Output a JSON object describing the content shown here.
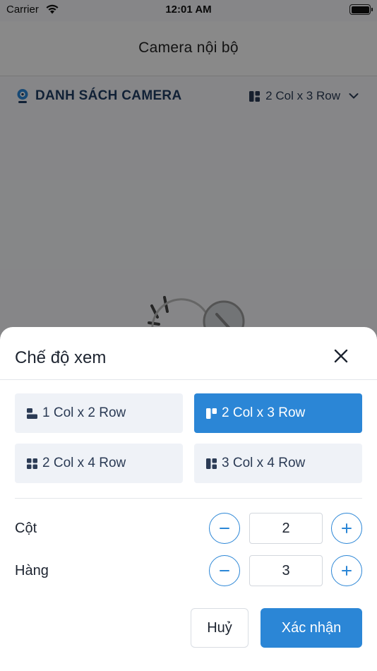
{
  "status_bar": {
    "carrier": "Carrier",
    "time": "12:01 AM"
  },
  "header": {
    "title": "Camera nội bộ"
  },
  "camera_list": {
    "title": "DANH SÁCH CAMERA",
    "current_layout": "2 Col x 3 Row"
  },
  "sheet": {
    "title": "Chế độ xem",
    "options": [
      {
        "label": "1 Col x 2 Row",
        "selected": false
      },
      {
        "label": "2 Col x 3 Row",
        "selected": true
      },
      {
        "label": "2 Col x 4 Row",
        "selected": false
      },
      {
        "label": "3 Col x 4 Row",
        "selected": false
      }
    ],
    "columns": {
      "label": "Cột",
      "value": "2"
    },
    "rows": {
      "label": "Hàng",
      "value": "3"
    },
    "cancel_label": "Huỷ",
    "confirm_label": "Xác nhận"
  },
  "colors": {
    "accent": "#2b86d6",
    "title_dark": "#1f3d63",
    "option_bg": "#eff2f7"
  },
  "icons": [
    "wifi-icon",
    "battery-icon",
    "camera-pin-icon",
    "grid-layout-icon",
    "chevron-down-icon",
    "close-icon",
    "minus-icon",
    "plus-icon"
  ]
}
